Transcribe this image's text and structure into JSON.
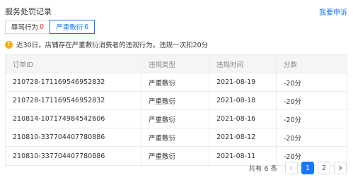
{
  "header": {
    "title": "服务处罚记录",
    "appeal_link": "我要申诉"
  },
  "tabs": [
    {
      "label": "辱骂行为",
      "count": "0"
    },
    {
      "label": "严重敷衍",
      "count": "6"
    }
  ],
  "notice": {
    "text": "近30日，店铺存在严重敷衍消费者的违规行为，违规一次扣20分"
  },
  "table": {
    "columns": [
      "订单ID",
      "违规类型",
      "违规时间",
      "分数"
    ],
    "rows": [
      [
        "210728-171169546952832",
        "严重敷衍",
        "2021-08-19",
        "-20分"
      ],
      [
        "210728-171169546952832",
        "严重敷衍",
        "2021-08-18",
        "-20分"
      ],
      [
        "210814-107174984542606",
        "严重敷衍",
        "2021-08-16",
        "-20分"
      ],
      [
        "210810-337704407780886",
        "严重敷衍",
        "2021-08-12",
        "-20分"
      ],
      [
        "210810-337704407780886",
        "严重敷衍",
        "2021-08-11",
        "-20分"
      ]
    ]
  },
  "pagination": {
    "total_text": "共有 6 条",
    "pages": [
      "1",
      "2"
    ],
    "current": "1"
  },
  "colors": {
    "accent": "#1677ff",
    "warning": "#faad14",
    "danger": "#f5222d"
  }
}
